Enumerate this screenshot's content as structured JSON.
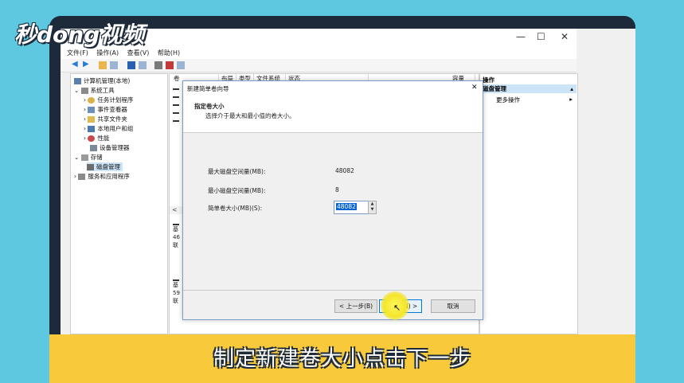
{
  "logo": "秒dong视频",
  "caption": "制定新建卷大小点击下一步",
  "colors": {
    "background": "#5ec8e0",
    "caption_bar": "#f7c93b",
    "selection": "#cce4f7",
    "highlight": "#fff75a"
  },
  "window": {
    "controls": [
      "—",
      "☐",
      "✕"
    ]
  },
  "menu": [
    "文件(F)",
    "操作(A)",
    "查看(V)",
    "帮助(H)"
  ],
  "tree": {
    "items": [
      {
        "label": "计算机管理(本地)",
        "icon": "computer-icon"
      },
      {
        "label": "系统工具",
        "icon": "tools-icon"
      },
      {
        "label": "任务计划程序",
        "icon": "clock-icon"
      },
      {
        "label": "事件查看器",
        "icon": "event-viewer-icon"
      },
      {
        "label": "共享文件夹",
        "icon": "shared-folder-icon"
      },
      {
        "label": "本地用户和组",
        "icon": "users-icon"
      },
      {
        "label": "性能",
        "icon": "performance-icon"
      },
      {
        "label": "设备管理器",
        "icon": "device-manager-icon"
      },
      {
        "label": "存储",
        "icon": "storage-icon"
      },
      {
        "label": "磁盘管理",
        "icon": "disk-icon"
      },
      {
        "label": "服务和应用程序",
        "icon": "services-icon"
      }
    ]
  },
  "center": {
    "columns": [
      "卷",
      "布局",
      "类型",
      "文件系统",
      "状态",
      "容量"
    ],
    "disk_rows": [
      {
        "l1": "基",
        "l2": "46",
        "l3": "联"
      },
      {
        "l1": "基",
        "l2": "59",
        "l3": "联"
      }
    ],
    "scroll_left": "<"
  },
  "actions": {
    "header": "操作",
    "selected": "磁盘管理",
    "more": "更多操作"
  },
  "wizard": {
    "title": "新建简单卷向导",
    "close": "✕",
    "heading": "指定卷大小",
    "subheading": "选择介于最大和最小值的卷大小。",
    "max_label": "最大磁盘空间量(MB):",
    "max_value": "48082",
    "min_label": "最小磁盘空间量(MB):",
    "min_value": "8",
    "size_label": "简单卷大小(MB)(S):",
    "size_value": "48082",
    "back_button": "< 上一步(B)",
    "next_button": "下一步(N) >",
    "cancel_button": "取消"
  }
}
